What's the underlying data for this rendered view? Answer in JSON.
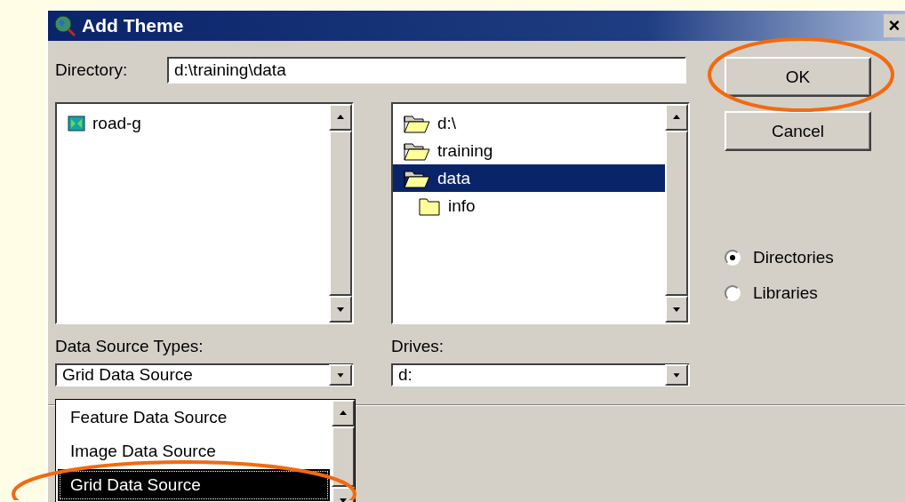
{
  "window": {
    "title": "Add Theme",
    "close": "×"
  },
  "directory": {
    "label": "Directory:",
    "value": "d:\\training\\data"
  },
  "sources": [
    {
      "name": "road-g",
      "selected": false
    }
  ],
  "folders": [
    {
      "name": "d:\\",
      "kind": "open",
      "selected": false
    },
    {
      "name": "training",
      "kind": "open",
      "selected": false
    },
    {
      "name": "data",
      "kind": "open",
      "selected": true,
      "children": [
        {
          "name": "info",
          "kind": "closed",
          "selected": false
        }
      ]
    }
  ],
  "buttons": [
    {
      "label": "OK",
      "circled": true
    },
    {
      "label": "Cancel",
      "circled": false
    }
  ],
  "view": [
    {
      "label": "Directories",
      "selected": true
    },
    {
      "label": "Libraries",
      "selected": false
    }
  ],
  "source_types": {
    "label": "Data Source Types:",
    "value": "Grid Data Source",
    "expanded": true,
    "options": [
      {
        "label": "Feature Data Source",
        "selected": false,
        "circled": false
      },
      {
        "label": "Image Data Source",
        "selected": false,
        "circled": false
      },
      {
        "label": "Grid Data Source",
        "selected": true,
        "circled": true
      }
    ]
  },
  "drives": {
    "label": "Drives:",
    "value": "d:"
  }
}
